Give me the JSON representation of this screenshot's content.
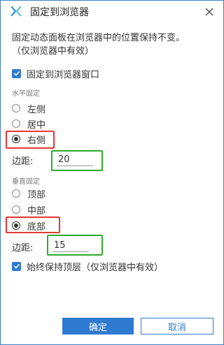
{
  "window": {
    "title": "固定到浏览器",
    "accent_color": "#2e7bd1",
    "app_icon": "x-logo-icon",
    "close_icon": "close-icon"
  },
  "description": {
    "line1": "固定动态面板在浏览器中的位置保持不变。",
    "line2": "（仅浏览器中有效）"
  },
  "pin_to_window": {
    "label": "固定到浏览器窗口",
    "checked": true
  },
  "horizontal": {
    "section_label": "水平固定",
    "options": [
      {
        "label": "左侧",
        "checked": false
      },
      {
        "label": "居中",
        "checked": false
      },
      {
        "label": "右侧",
        "checked": true
      }
    ],
    "margin_label": "边距:",
    "margin_value": "20"
  },
  "vertical": {
    "section_label": "垂直固定",
    "options": [
      {
        "label": "顶部",
        "checked": false
      },
      {
        "label": "中部",
        "checked": false
      },
      {
        "label": "底部",
        "checked": true
      }
    ],
    "margin_label": "边距:",
    "margin_value": "15"
  },
  "always_on_top": {
    "label": "始终保持顶层（仅浏览器中有效）",
    "checked": true
  },
  "buttons": {
    "ok": "确定",
    "cancel": "取消"
  }
}
